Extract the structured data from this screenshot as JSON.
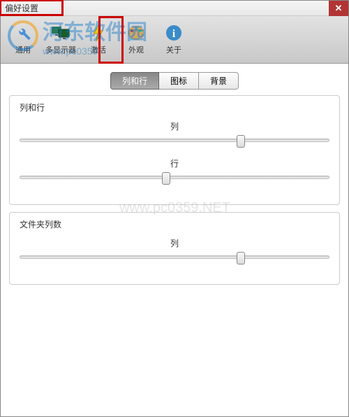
{
  "window": {
    "title": "偏好设置"
  },
  "toolbar": {
    "items": [
      {
        "label": "通用"
      },
      {
        "label": "多显示器"
      },
      {
        "label": "激活"
      },
      {
        "label": "外观"
      },
      {
        "label": "关于"
      }
    ]
  },
  "tabs": {
    "items": [
      {
        "label": "列和行",
        "selected": true
      },
      {
        "label": "图标"
      },
      {
        "label": "背景"
      }
    ]
  },
  "panel1": {
    "title": "列和行",
    "slider1": {
      "label": "列",
      "pos_pct": 70
    },
    "slider2": {
      "label": "行",
      "pos_pct": 46
    }
  },
  "panel2": {
    "title": "文件夹列数",
    "slider1": {
      "label": "列",
      "pos_pct": 70
    }
  },
  "watermark": {
    "text": "河东软件园",
    "sub": "www.pc0359.",
    "mid": "www.pc0359.NET"
  }
}
